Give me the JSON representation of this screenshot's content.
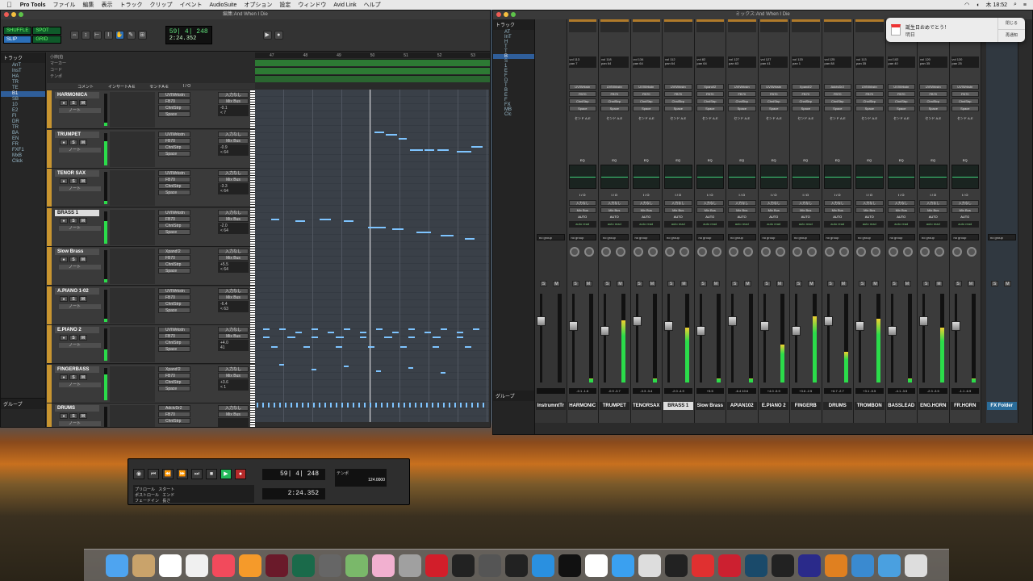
{
  "menubar": {
    "app": "Pro Tools",
    "items": [
      "ファイル",
      "編集",
      "表示",
      "トラック",
      "クリップ",
      "イベント",
      "AudioSuite",
      "オプション",
      "設定",
      "ウィンドウ",
      "Avid Link",
      "ヘルプ"
    ],
    "clock": "木 18:52"
  },
  "edit_window": {
    "title": "編集:And When I Die",
    "counter_main": "59| 4| 248",
    "counter_sub": "2:24.352",
    "mode_labels": [
      "SHUFFLE",
      "SPOT",
      "SLIP",
      "GRID"
    ],
    "tracks_header": "トラック",
    "groups_header": "グループ",
    "ruler_bars": [
      "47",
      "48",
      "49",
      "50",
      "51",
      "52",
      "53"
    ],
    "ruler_rows": [
      "小節|拍",
      "マーカー",
      "コード",
      "テンポ"
    ],
    "column_headers": [
      "コメント",
      "インサートA-E",
      "センドA-E",
      "I / O"
    ],
    "track_list": [
      "AnT",
      "InsT",
      "HA",
      "TR",
      "TE",
      "B1",
      "SB",
      "10",
      "E2",
      "FI",
      "DR",
      "TR",
      "BA",
      "EN",
      "FR",
      "FXF1",
      "MxB",
      "Click"
    ],
    "tracks": [
      {
        "name": "HARMONICA",
        "inserts": [
          "UVIWrkstn",
          "FB70",
          "ChnlStrp",
          "Space"
        ],
        "io_in": "入力なし",
        "io_out": "Mix Bus",
        "vol": "-0.1",
        "pan": "< 7"
      },
      {
        "name": "TRUMPET",
        "inserts": [
          "UVIWrkstn",
          "FB70",
          "ChnlStrp",
          "Space"
        ],
        "io_in": "入力なし",
        "io_out": "Mix Bus",
        "vol": "-0.9",
        "pan": "< 64"
      },
      {
        "name": "TENOR SAX",
        "inserts": [
          "UVIWrkstn",
          "FB70",
          "ChnlStrp",
          "Space"
        ],
        "io_in": "入力なし",
        "io_out": "Mix Bus",
        "vol": "-3.3",
        "pan": "< 64"
      },
      {
        "name": "BRASS 1",
        "inserts": [
          "UVIWrkstn",
          "FB70",
          "ChnlStrp",
          "Space"
        ],
        "io_in": "入力なし",
        "io_out": "Mix Bus",
        "vol": "-2.0",
        "pan": "< 64"
      },
      {
        "name": "Slow Brass",
        "inserts": [
          "Xpand!2",
          "FB70",
          "ChnlStrp",
          "Space"
        ],
        "io_in": "入力なし",
        "io_out": "Mix Bus",
        "vol": "+5.5",
        "pan": "< 64"
      },
      {
        "name": "A.PIANO 1-02",
        "inserts": [
          "UVIWrkstn",
          "FB70",
          "ChnlStrp",
          "Space"
        ],
        "io_in": "入力なし",
        "io_out": "Mix Bus",
        "vol": "-6.4",
        "pan": "< 63"
      },
      {
        "name": "E.PIANO 2",
        "inserts": [
          "UVIWrkstn",
          "FB70",
          "ChnlStrp",
          "Space"
        ],
        "io_in": "入力なし",
        "io_out": "Mix Bus",
        "vol": "+4.0",
        "pan": "41"
      },
      {
        "name": "FINGERBASS",
        "inserts": [
          "Xpand!2",
          "FB70",
          "ChnlStrp",
          "Space"
        ],
        "io_in": "入力なし",
        "io_out": "Mix Bus",
        "vol": "+3.6",
        "pan": "< 1"
      },
      {
        "name": "DRUMS",
        "inserts": [
          "AdctvDr2",
          "FB70",
          "ChnlStrp"
        ],
        "io_in": "入力なし",
        "io_out": "Mix Bus",
        "vol": "",
        "pan": ""
      }
    ],
    "playlist_label": "ノート",
    "track_meters": [
      0.1,
      0.75,
      0.1,
      0.7,
      0.1,
      0.1,
      0.35,
      0.8,
      0.1
    ]
  },
  "mix_window": {
    "title": "ミックス:And When I Die",
    "tracks_header": "トラック",
    "groups_header": "グループ",
    "track_list": [
      "AT",
      "InT",
      "H",
      "T",
      "T",
      "B",
      "S",
      "1",
      "E",
      "F",
      "D",
      "T",
      "B",
      "E",
      "F",
      "FX",
      "MB",
      "Clc"
    ],
    "send_label": "センド A-E",
    "eq_label": "EQ",
    "io_label": "I / O",
    "io_in": "入力なし",
    "io_out": "Mix Bus",
    "auto_label": "AUTO",
    "auto_mode": "auto read",
    "group_label": "no group",
    "strips": [
      {
        "name": "InstrumntTr",
        "vol": "",
        "pan": "",
        "inserts": [],
        "peak": "",
        "level": 0
      },
      {
        "name": "HARMONIC",
        "vol": "113",
        "pan": "7",
        "inserts": [
          "UVIWrkstn",
          "FB70",
          "ChnlStrp",
          "Space"
        ],
        "peak": "-0.1  -1.6",
        "level": 0.05
      },
      {
        "name": "TRUMPET",
        "vol": "118",
        "pan": "64",
        "inserts": [
          "UVIWrkstn",
          "FB70",
          "ChnlStrp",
          "Space"
        ],
        "peak": "-0.9  -3.7",
        "level": 0.7
      },
      {
        "name": "TENORSAX",
        "vol": "134",
        "pan": "64",
        "inserts": [
          "UVIWrkstn",
          "FB70",
          "ChnlStrp",
          "Space"
        ],
        "peak": "-3.3  -3.4",
        "level": 0.05
      },
      {
        "name": "BRASS 1",
        "vol": "112",
        "pan": "64",
        "inserts": [
          "UVIWrkstn",
          "FB70",
          "ChnlStrp",
          "Space"
        ],
        "peak": "-2.0  -4.9",
        "level": 0.62
      },
      {
        "name": "Slow Brass",
        "vol": "82",
        "pan": "64",
        "inserts": [
          "Xpand!2",
          "FB70",
          "ChnlStrp",
          "Space"
        ],
        "peak": "+5.5",
        "level": 0.05
      },
      {
        "name": "APIAN102",
        "vol": "127",
        "pan": "63",
        "inserts": [
          "UVIWrkstn",
          "FB70",
          "ChnlStrp",
          "Space"
        ],
        "peak": "-6.4  10.6",
        "level": 0.05
      },
      {
        "name": "E.PIANO 2",
        "vol": "127",
        "pan": "41",
        "inserts": [
          "UVIWrkstn",
          "FB70",
          "ChnlStrp",
          "Space"
        ],
        "peak": "+4.0  -5.9",
        "level": 0.43
      },
      {
        "name": "FINGERB",
        "vol": "120",
        "pan": "1",
        "inserts": [
          "Xpand!2",
          "FB70",
          "ChnlStrp",
          "Space"
        ],
        "peak": "+3.6  -2.5",
        "level": 0.75
      },
      {
        "name": "DRUMS",
        "vol": "125",
        "pan": "88",
        "inserts": [
          "AdctvDr2",
          "FB70",
          "ChnlStrp",
          "Space"
        ],
        "peak": "+6.7  -2.7",
        "level": 0.35
      },
      {
        "name": "TROMBON",
        "vol": "113",
        "pan": "35",
        "inserts": [
          "UVIWrkstn",
          "FB70",
          "ChnlStrp",
          "Space"
        ],
        "peak": "+3.1  -5.5",
        "level": 0.72
      },
      {
        "name": "BASSLEAD",
        "vol": "102",
        "pan": "40",
        "inserts": [
          "UVIWrkstn",
          "FB70",
          "ChnlStrp",
          "Space"
        ],
        "peak": "-4.1  -3.5",
        "level": 0.05
      },
      {
        "name": "ENG.HORN",
        "vol": "120",
        "pan": "35",
        "inserts": [
          "UVIWrkstn",
          "FB70",
          "ChnlStrp",
          "Space"
        ],
        "peak": "-2.3  -3.5",
        "level": 0.62
      },
      {
        "name": "FR.HORN",
        "vol": "120",
        "pan": "25",
        "inserts": [
          "UVIWrkstn",
          "FB70",
          "ChnlStrp",
          "Space"
        ],
        "peak": "-1.1  -6.9",
        "level": 0.05
      }
    ],
    "fx_strip": {
      "name": "FX Folder"
    }
  },
  "notification": {
    "title": "誕生日おめでとう！",
    "subtitle": "明日",
    "close": "閉じる",
    "reopen": "再通知"
  },
  "transport": {
    "counter_main": "59| 4| 248",
    "counter_sub": "2:24.352",
    "preroll": "プリロール",
    "postroll": "ポストロール",
    "fadein": "フェードイン",
    "start": "スタート",
    "end": "エンド",
    "length": "長さ",
    "tempo": "124.0000",
    "tempo_label": "テンポ"
  },
  "dock_icons": [
    "finder-icon",
    "launchpad-icon",
    "calendar-icon",
    "photos-icon",
    "music-icon",
    "books-icon",
    "mixer-app-icon",
    "timemachine-icon",
    "sysprefs-icon",
    "maps-icon",
    "photos2-icon",
    "tools-icon",
    "pod-icon",
    "dog-icon",
    "mbox-icon",
    "piano-icon",
    "quicktime-icon",
    "ilok-icon",
    "x-icon",
    "safari-icon",
    "plugin-icon",
    "waves-icon",
    "ew-icon",
    "ik-icon",
    "link-icon",
    "waves2-icon",
    "avid-icon",
    "rt-icon",
    "appfolder-icon",
    "docs-icon",
    "trash-icon"
  ]
}
